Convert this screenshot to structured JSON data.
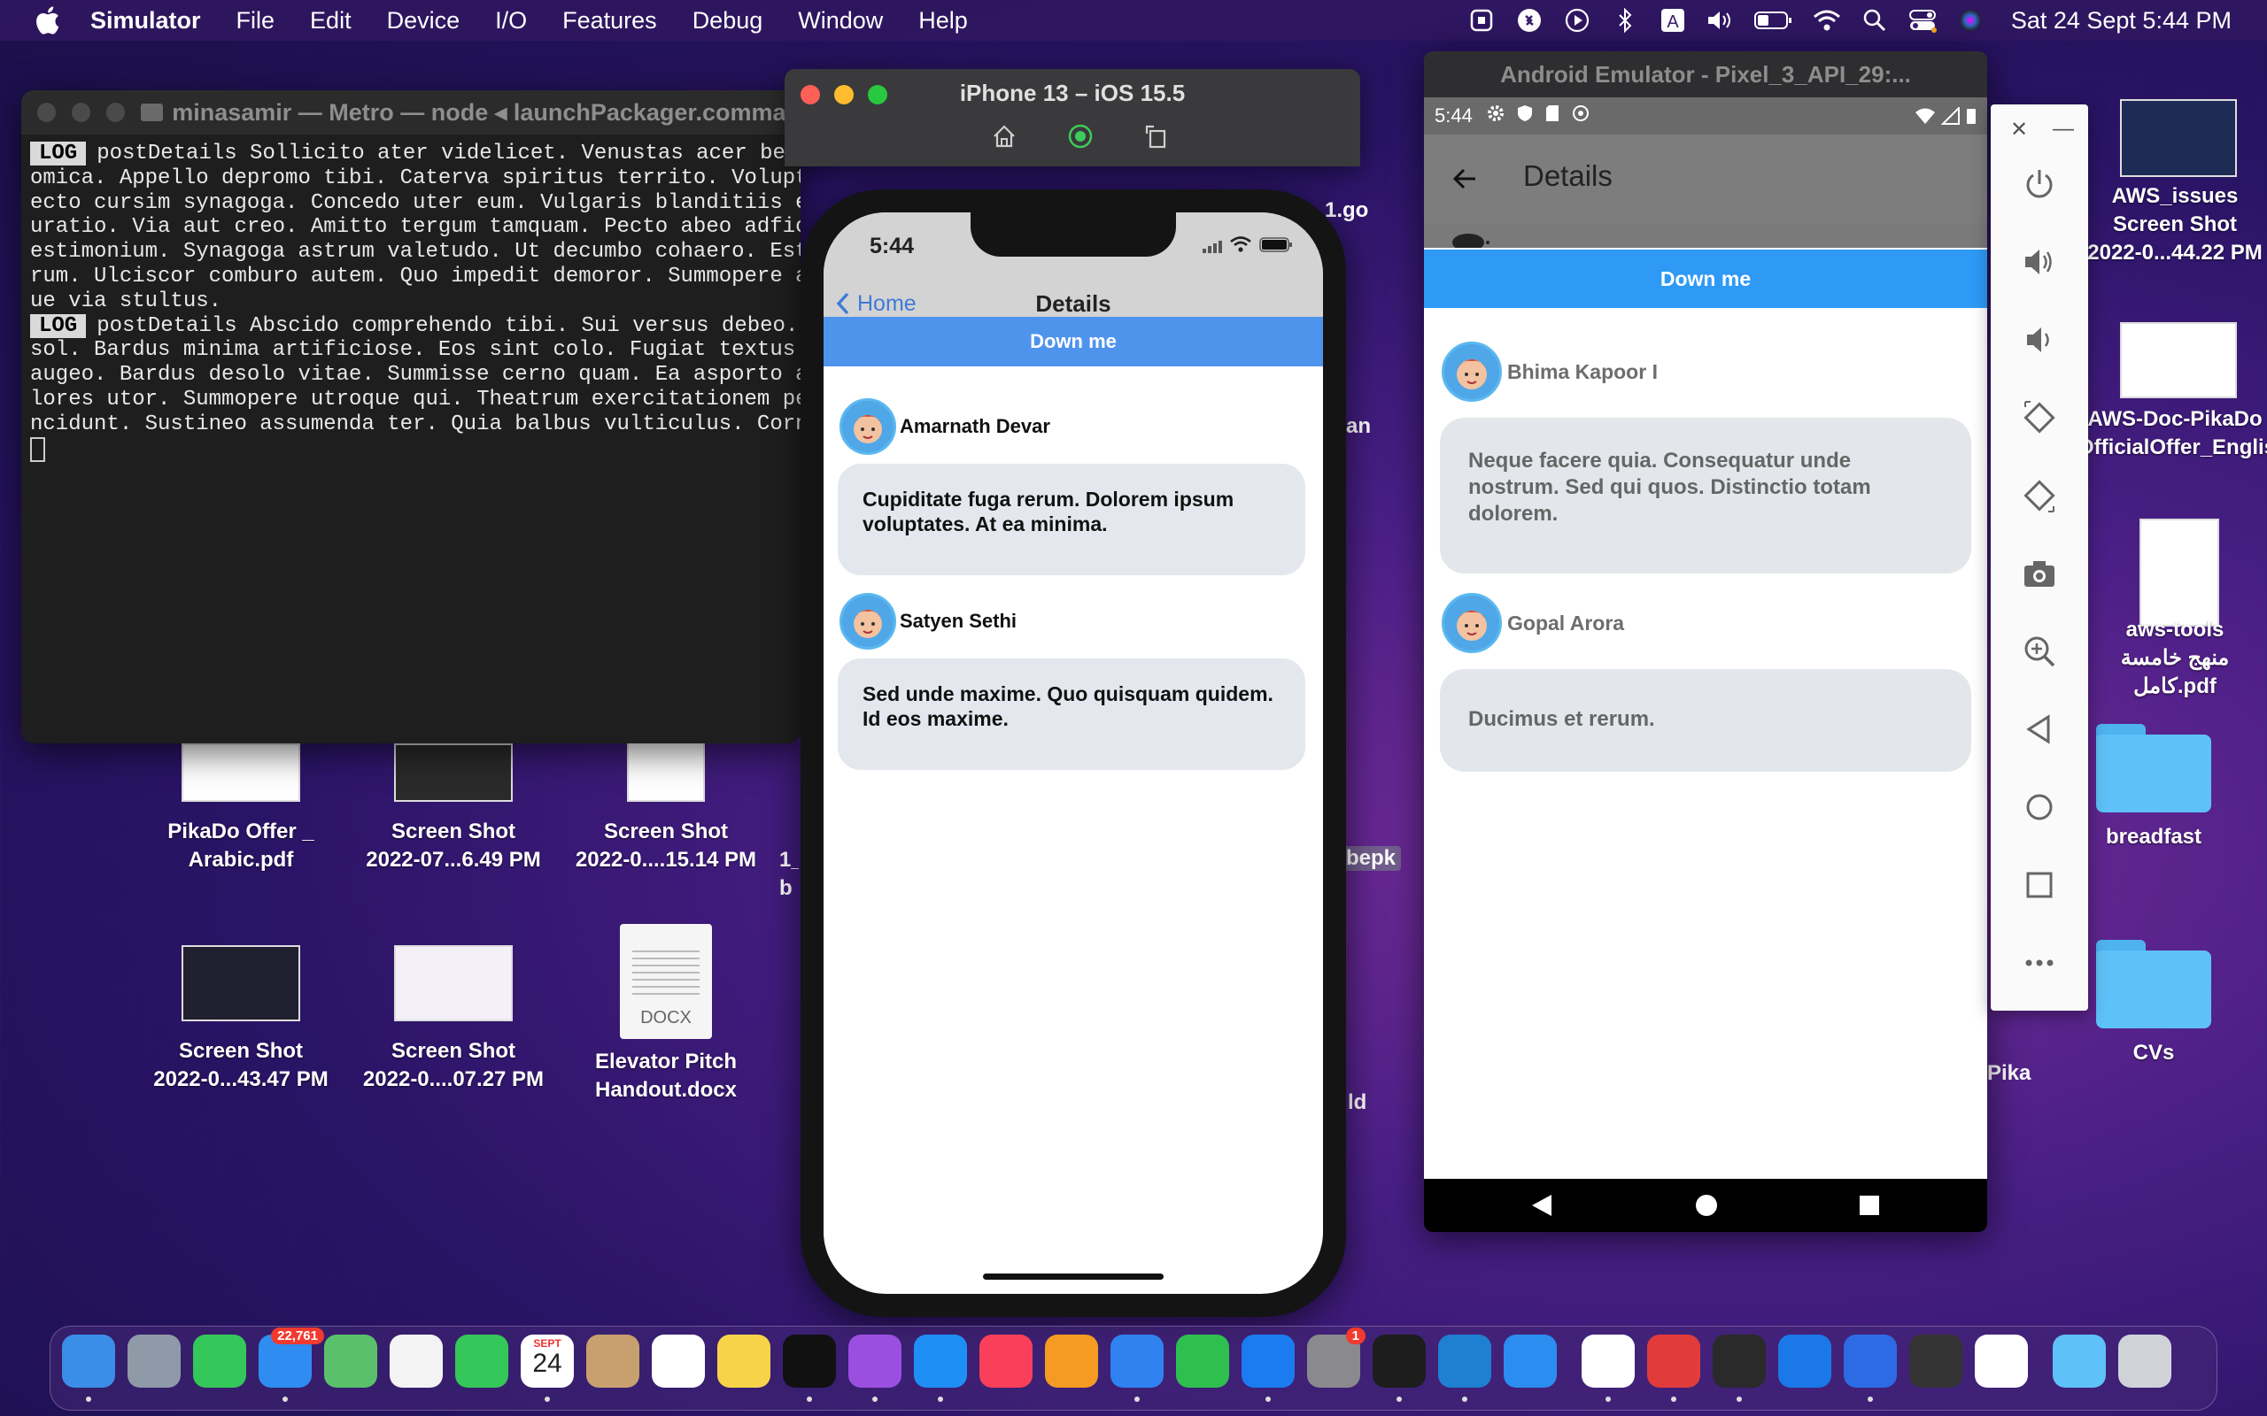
{
  "menubar": {
    "app_name": "Simulator",
    "menus": [
      "File",
      "Edit",
      "Device",
      "I/O",
      "Features",
      "Debug",
      "Window",
      "Help"
    ],
    "clock": "Sat 24 Sept  5:44 PM",
    "status_icons": [
      "screen-record-icon",
      "shazam-icon",
      "play-icon",
      "bluetooth-icon",
      "input-source-icon",
      "volume-icon",
      "battery-icon",
      "wifi-icon",
      "search-icon",
      "control-center-icon",
      "siri-icon"
    ]
  },
  "desktop": {
    "icons": [
      {
        "label": "PikaDo Offer _\nArabic.pdf"
      },
      {
        "label": "Screen Shot\n2022-07...6.49 PM"
      },
      {
        "label": "Screen Shot\n2022-0....15.14 PM"
      },
      {
        "label": "Screen Shot\n2022-0...43.47 PM"
      },
      {
        "label": "Screen Shot\n2022-0....07.27 PM"
      },
      {
        "label": "Elevator Pitch\nHandout.docx",
        "badge": "DOCX"
      },
      {
        "label": "AWS_issues\nScreen Shot\n2022-0...44.22 PM"
      },
      {
        "label": "AWS-Doc-PikaDo\nOfficialOffer_English.pdf"
      },
      {
        "label": "aws-tools\nمنهج خامسة\nكامل.pdf"
      },
      {
        "label": "breadfast"
      },
      {
        "label": "CVs"
      },
      {
        "label": "Pika"
      },
      {
        "label": "1.go"
      },
      {
        "label": "an"
      },
      {
        "label": "bepk"
      },
      {
        "label": "ld"
      },
      {
        "label": "1_\nb"
      }
    ]
  },
  "terminal": {
    "title": "minasamir — Metro — node ◂ launchPackager.comman",
    "log_tag": "LOG",
    "lines": [
      {
        "log": true,
        "text": "postDetails Sollicito ater videlicet. Venustas acer ben"
      },
      {
        "log": false,
        "text": "omica. Appello depromo tibi. Caterva spiritus territo. Voluptas id agnitio. Coni"
      },
      {
        "log": false,
        "text": "ecto cursim synagoga. Concedo uter eum. Vulgaris blanditiis eius"
      },
      {
        "log": false,
        "text": "uratio. Via aut creo. Amitto tergum tamquam. Pecto abeo adficio"
      },
      {
        "log": false,
        "text": "estimonium. Synagoga astrum valetudo. Ut decumbo cohaero. Est"
      },
      {
        "log": false,
        "text": "rum. Ulciscor comburo autem. Quo impedit demoror. Summopere ap"
      },
      {
        "log": false,
        "text": "ue via stultus."
      },
      {
        "log": true,
        "text": "postDetails Abscido comprehendo tibi. Sui versus debeo."
      },
      {
        "log": false,
        "text": "sol. Bardus minima artificiose. Eos sint colo. Fugiat textus s"
      },
      {
        "log": false,
        "text": "augeo. Bardus desolo vitae. Summisse cerno quam. Ea asporto at"
      },
      {
        "log": false,
        "text": "lores utor. Summopere utroque qui. Theatrum exercitationem pei"
      },
      {
        "log": false,
        "text": "ncidunt. Sustineo assumenda ter. Quia balbus vulticulus. Cornu"
      }
    ]
  },
  "simulator": {
    "title": "iPhone 13 – iOS 15.5",
    "screen": {
      "time": "5:44",
      "back_label": "Home",
      "title": "Details",
      "button_label": "Down me",
      "comments": [
        {
          "author": "Amarnath Devar",
          "body": "Cupiditate fuga rerum. Dolorem ipsum voluptates. At ea minima."
        },
        {
          "author": "Satyen Sethi",
          "body": "Sed unde maxime. Quo quisquam quidem. Id eos maxime."
        }
      ]
    }
  },
  "android": {
    "title": "Android Emulator - Pixel_3_API_29:...",
    "screen": {
      "time": "5:44",
      "title": "Details",
      "button_label": "Down me",
      "comments": [
        {
          "author": "Bhima Kapoor I",
          "body": "Neque facere quia. Consequatur unde nostrum. Sed qui quos. Distinctio totam dolorem."
        },
        {
          "author": "Gopal Arora",
          "body": "Ducimus et rerum."
        }
      ]
    }
  },
  "dock": {
    "mail_badge": "22,761",
    "calendar_month": "SEPT",
    "calendar_day": "24",
    "settings_badge": "1",
    "apps": [
      "finder",
      "launchpad",
      "messages",
      "mail",
      "maps",
      "photos",
      "facetime",
      "calendar",
      "contacts",
      "reminders",
      "notes",
      "apple-tv",
      "podcasts",
      "app-store",
      "music",
      "pages",
      "keynote",
      "numbers",
      "xcode-instruments",
      "system-preferences",
      "terminal-dark",
      "vscode",
      "safari",
      "chrome",
      "pdf-reader",
      "terminal",
      "xcode",
      "simulator-xcode",
      "simulator",
      "android-studio",
      "downloads-folder",
      "trash"
    ]
  },
  "colors": {
    "ios_accent": "#4f94ec",
    "android_accent": "#2e9af6",
    "ios_back": "#3e7bd6"
  }
}
